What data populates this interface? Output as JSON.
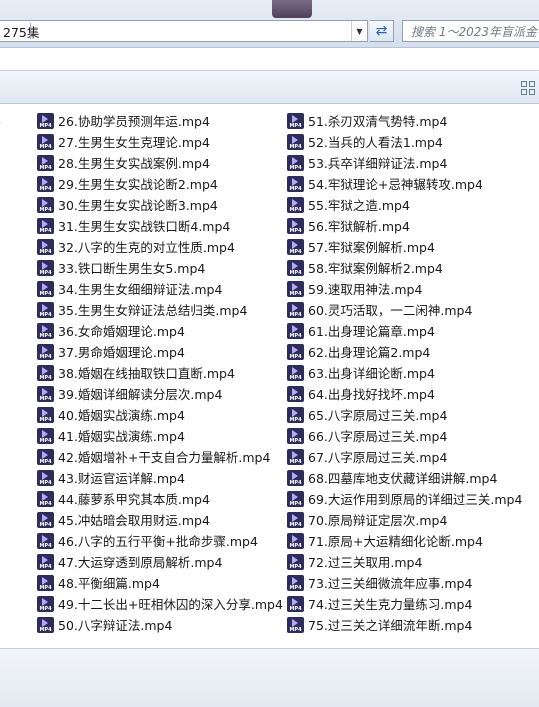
{
  "address_bar": {
    "path": "275集"
  },
  "search": {
    "placeholder": "搜索 1～2023年盲派金铂"
  },
  "files": {
    "col0": [
      "p4",
      "4"
    ],
    "col1": [
      "26.协助学员预测年运.mp4",
      "27.生男生女生克理论.mp4",
      "28.生男生女实战案例.mp4",
      "29.生男生女实战论断2.mp4",
      "30.生男生女实战论断3.mp4",
      "31.生男生女实战铁口断4.mp4",
      "32.八字的生克的对立性质.mp4",
      "33.铁口断生男生女5.mp4",
      "34.生男生女细细辩证法.mp4",
      "35.生男生女辩证法总结归类.mp4",
      "36.女命婚姻理论.mp4",
      "37.男命婚姻理论.mp4",
      "38.婚姻在线抽取铁口直断.mp4",
      "39.婚姻详细解读分层次.mp4",
      "40.婚姻实战演练.mp4",
      "41.婚姻实战演练.mp4",
      "42.婚姻增补+干支自合力量解析.mp4",
      "43.财运官运详解.mp4",
      "44.藤萝系甲究其本质.mp4",
      "45.冲姑暗会取用财运.mp4",
      "46.八字的五行平衡+批命步骤.mp4",
      "47.大运穿透到原局解析.mp4",
      "48.平衡细篇.mp4",
      "49.十二长出+旺相休囚的深入分享.mp4",
      "50.八字辩证法.mp4"
    ],
    "col2": [
      "51.杀刃双清气势特.mp4",
      "52.当兵的人看法1.mp4",
      "53.兵卒详细辩证法.mp4",
      "54.牢狱理论+忌神辗转攻.mp4",
      "55.牢狱之造.mp4",
      "56.牢狱解析.mp4",
      "57.牢狱案例解析.mp4",
      "58.牢狱案例解析2.mp4",
      "59.速取用神法.mp4",
      "60.灵巧活取，一二闲神.mp4",
      "61.出身理论篇章.mp4",
      "62.出身理论篇2.mp4",
      "63.出身详细论断.mp4",
      "64.出身找好找坏.mp4",
      "65.八字原局过三关.mp4",
      "66.八字原局过三关.mp4",
      "67.八字原局过三关.mp4",
      "68.四墓库地支伏藏详细讲解.mp4",
      "69.大运作用到原局的详细过三关.mp4",
      "70.原局辩证定层次.mp4",
      "71.原局+大运精细化论断.mp4",
      "72.过三关取用.mp4",
      "73.过三关细微流年应事.mp4",
      "74.过三关生克力量练习.mp4",
      "75.过三关之详细流年断.mp4"
    ]
  }
}
